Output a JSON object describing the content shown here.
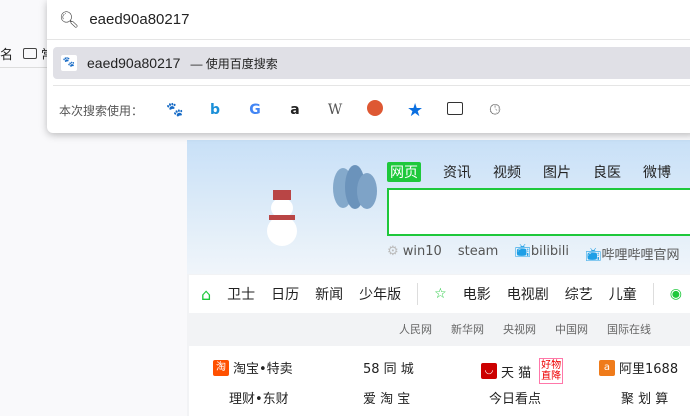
{
  "bookmarks": {
    "partial_left": "名",
    "folder_label": "常"
  },
  "omnibox": {
    "query": "eaed90a80217"
  },
  "suggestion": {
    "text": "eaed90a80217",
    "suffix": "— 使用百度搜索"
  },
  "engines": {
    "label": "本次搜索使用：",
    "items": [
      "baidu",
      "bing",
      "google",
      "amazon",
      "wikipedia",
      "duckduckgo",
      "bookmarks",
      "tabs",
      "history"
    ]
  },
  "page": {
    "tabs": [
      "网页",
      "资讯",
      "视频",
      "图片",
      "良医",
      "微博"
    ],
    "hot": [
      "win10",
      "steam",
      "bilibili",
      "哔哩哔哩官网"
    ],
    "nav": [
      "卫士",
      "日历",
      "新闻",
      "少年版",
      "电影",
      "电视剧",
      "综艺",
      "儿童"
    ],
    "links": [
      "人民网",
      "新华网",
      "央视网",
      "中国网",
      "国际在线"
    ],
    "sites": [
      "淘宝•特卖",
      "58 同 城",
      "天 猫",
      "阿里1688",
      "理财•东财",
      "爱 淘 宝",
      "今日看点",
      "聚 划 算"
    ],
    "tmall_badge": [
      "好物",
      "直降"
    ],
    "accent": "#1ec83b"
  }
}
